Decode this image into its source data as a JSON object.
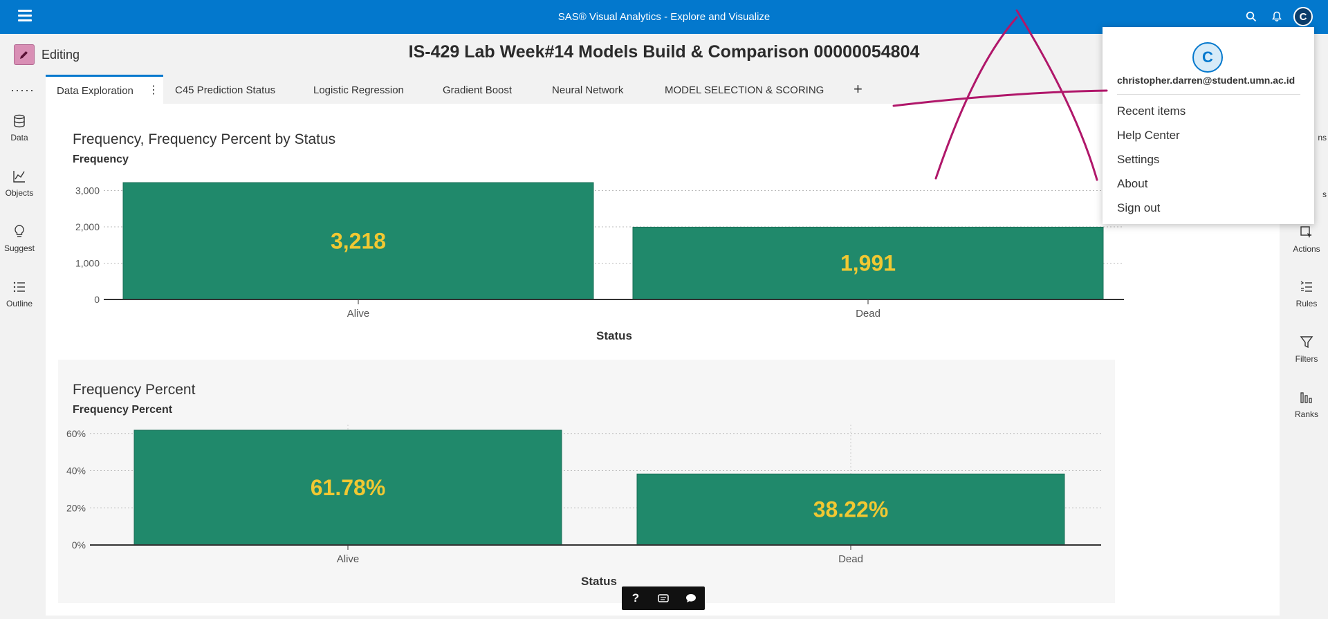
{
  "app": {
    "title": "SAS® Visual Analytics - Explore and Visualize",
    "user_initial": "C"
  },
  "header": {
    "mode_label": "Editing",
    "report_title": "IS-429 Lab Week#14 Models Build & Comparison 00000054804"
  },
  "left_rail": {
    "items": [
      {
        "label": "Data",
        "icon": "database-icon"
      },
      {
        "label": "Objects",
        "icon": "line-chart-icon"
      },
      {
        "label": "Suggest",
        "icon": "lightbulb-icon"
      },
      {
        "label": "Outline",
        "icon": "list-icon"
      }
    ]
  },
  "right_rail": {
    "items": [
      {
        "label": "Actions",
        "icon": "actions-icon"
      },
      {
        "label": "Rules",
        "icon": "rules-icon"
      },
      {
        "label": "Filters",
        "icon": "filter-icon"
      },
      {
        "label": "Ranks",
        "icon": "ranks-icon"
      }
    ],
    "partial_labels": [
      "ns",
      "s"
    ]
  },
  "tabs": [
    {
      "label": "Data Exploration",
      "active": true
    },
    {
      "label": "C45 Prediction Status"
    },
    {
      "label": "Logistic Regression"
    },
    {
      "label": "Gradient Boost"
    },
    {
      "label": "Neural Network"
    },
    {
      "label": "MODEL SELECTION & SCORING"
    }
  ],
  "user_menu": {
    "initial": "C",
    "email": "christopher.darren@student.umn.ac.id",
    "items": [
      "Recent items",
      "Help Center",
      "Settings",
      "About",
      "Sign out"
    ]
  },
  "colors": {
    "topbar": "#0378cd",
    "bar": "#20896b",
    "bar_label": "#f1c832",
    "annotation": "#b0176a"
  },
  "chart_data": [
    {
      "type": "bar",
      "title": "Frequency, Frequency Percent by Status",
      "ylabel": "Frequency",
      "xlabel": "Status",
      "categories": [
        "Alive",
        "Dead"
      ],
      "values": [
        3218,
        1991
      ],
      "data_labels": [
        "3,218",
        "1,991"
      ],
      "yticks": [
        0,
        1000,
        2000,
        3000
      ],
      "ytick_labels": [
        "0",
        "1,000",
        "2,000",
        "3,000"
      ],
      "ylim": [
        0,
        3218
      ],
      "grid": true
    },
    {
      "type": "bar",
      "title": "Frequency Percent",
      "ylabel": "Frequency Percent",
      "xlabel": "Status",
      "categories": [
        "Alive",
        "Dead"
      ],
      "values": [
        61.78,
        38.22
      ],
      "data_labels": [
        "61.78%",
        "38.22%"
      ],
      "yticks": [
        0,
        20,
        40,
        60
      ],
      "ytick_labels": [
        "0%",
        "20%",
        "40%",
        "60%"
      ],
      "ylim": [
        0,
        61.78
      ],
      "grid": true
    }
  ]
}
